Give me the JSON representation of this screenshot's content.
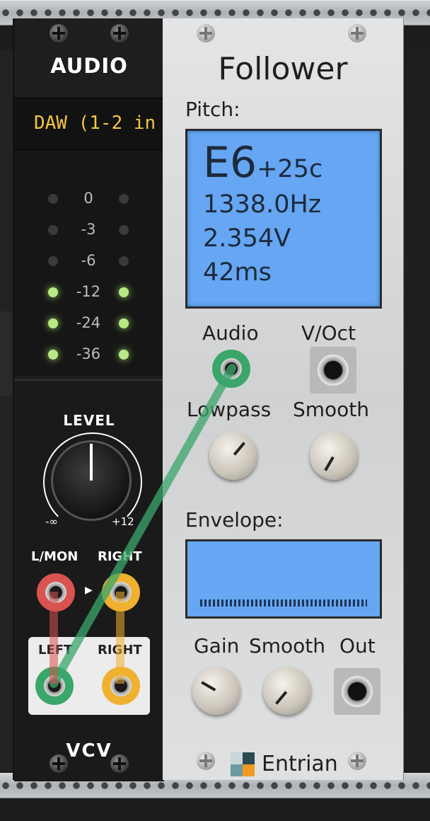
{
  "colors": {
    "accent_lcd": "#66a6f2",
    "meter_led_on": "#b8e986",
    "device_text": "#f3c543",
    "cable_green": "#3aa66a",
    "cable_red": "#d9534f",
    "cable_yellow": "#f0b030"
  },
  "audio_module": {
    "title": "AUDIO",
    "device": "DAW (1-2 in",
    "meter_levels": [
      "0",
      "-3",
      "-6",
      "-12",
      "-24",
      "-36"
    ],
    "meter_lit": [
      false,
      false,
      false,
      true,
      true,
      true
    ],
    "level": {
      "label": "LEVEL",
      "min_label": "-∞",
      "max_label": "+12"
    },
    "inputs": {
      "left_label": "L/MON",
      "right_label": "RIGHT"
    },
    "outputs": {
      "left_label": "LEFT",
      "right_label": "RIGHT"
    },
    "brand": "VCV"
  },
  "follower_module": {
    "title": "Follower",
    "pitch_label": "Pitch:",
    "display": {
      "note": "E6",
      "cents": "+25c",
      "frequency": "1338.0Hz",
      "voltage": "2.354V",
      "time": "42ms"
    },
    "audio_label": "Audio",
    "voct_label": "V/Oct",
    "lowpass_label": "Lowpass",
    "smooth_label": "Smooth",
    "envelope_label": "Envelope:",
    "gain_label": "Gain",
    "smooth2_label": "Smooth",
    "out_label": "Out",
    "brand": "Entrian"
  }
}
